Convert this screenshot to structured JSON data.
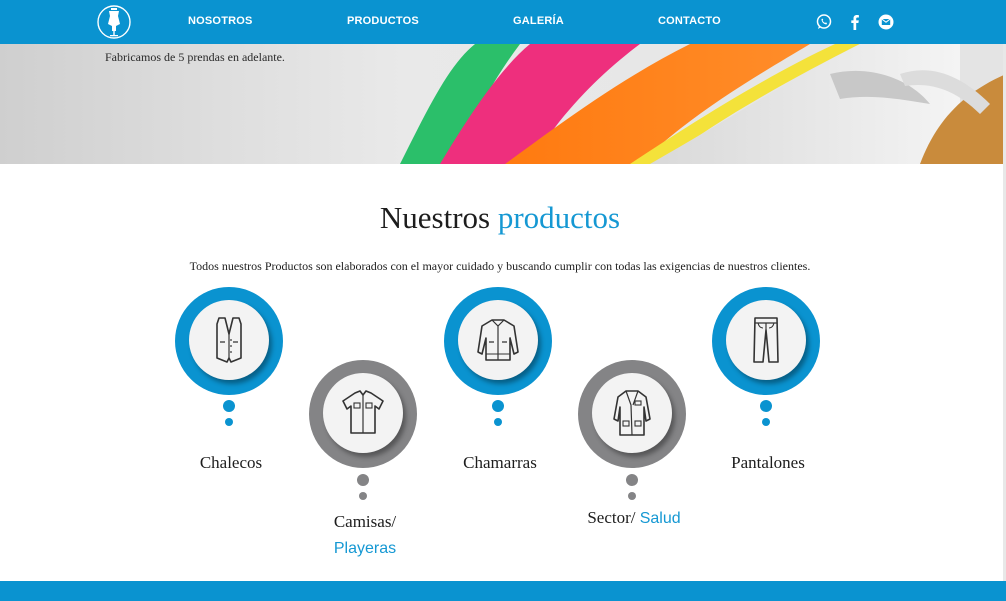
{
  "nav": {
    "links": [
      "NOSOTROS",
      "PRODUCTOS",
      "GALERÍA",
      "CONTACTO"
    ],
    "social_icons": [
      "whatsapp-icon",
      "facebook-icon",
      "email-icon"
    ],
    "brand_color": "#0a93d0"
  },
  "hero": {
    "text": "Fabricamos de 5 prendas en adelante."
  },
  "products_section": {
    "title_main": "Nuestros",
    "title_accent": "productos",
    "description": "Todos nuestros Productos son elaborados con el mayor cuidado y buscando cumplir con todas las exigencias de nuestros clientes.",
    "accent_color": "#1598d3",
    "items": [
      {
        "label": "Chalecos",
        "label_accent": "",
        "icon": "vest-icon",
        "ring_color": "blue"
      },
      {
        "label": "Camisas/",
        "label_accent": "Playeras",
        "icon": "shirt-icon",
        "ring_color": "gray"
      },
      {
        "label": "Chamarras",
        "label_accent": "",
        "icon": "jacket-icon",
        "ring_color": "blue"
      },
      {
        "label": "Sector/",
        "label_accent": "Salud",
        "icon": "lab-coat-icon",
        "ring_color": "gray"
      },
      {
        "label": "Pantalones",
        "label_accent": "",
        "icon": "pants-icon",
        "ring_color": "blue"
      }
    ]
  }
}
